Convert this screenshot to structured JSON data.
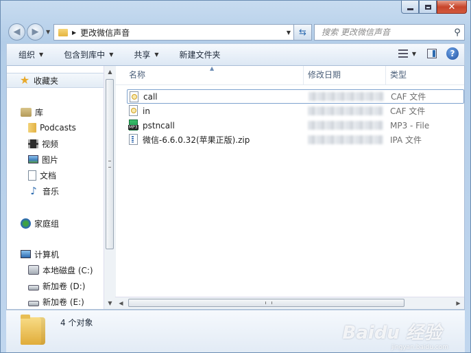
{
  "titlebar": {
    "min": "",
    "max": "",
    "close": "✕"
  },
  "nav": {
    "back_glyph": "◀",
    "fwd_glyph": "▶",
    "path": "更改微信声音",
    "search_placeholder": "搜索 更改微信声音"
  },
  "toolbar": {
    "organize": "组织",
    "include_library": "包含到库中",
    "share": "共享",
    "new_folder": "新建文件夹"
  },
  "sidebar": {
    "favorites": "收藏夹",
    "libraries": "库",
    "library_items": [
      "Podcasts",
      "视频",
      "图片",
      "文档",
      "音乐"
    ],
    "homegroup": "家庭组",
    "computer": "计算机",
    "drives": [
      "本地磁盘 (C:)",
      "新加卷 (D:)",
      "新加卷 (E:)"
    ]
  },
  "columns": {
    "name": "名称",
    "date": "修改日期",
    "type": "类型"
  },
  "files": [
    {
      "name": "call",
      "type": "CAF 文件",
      "icon": "caf-icon"
    },
    {
      "name": "in",
      "type": "CAF 文件",
      "icon": "caf-icon"
    },
    {
      "name": "pstncall",
      "type": "MP3 - File",
      "icon": "mp3-icon"
    },
    {
      "name": "微信-6.6.0.32(苹果正版).zip",
      "type": "IPA 文件",
      "icon": "zip-icon"
    }
  ],
  "details": {
    "count": "4 个对象"
  },
  "watermark": {
    "brand": "Baidu 经验",
    "url": "jingyan.baidu.com"
  }
}
